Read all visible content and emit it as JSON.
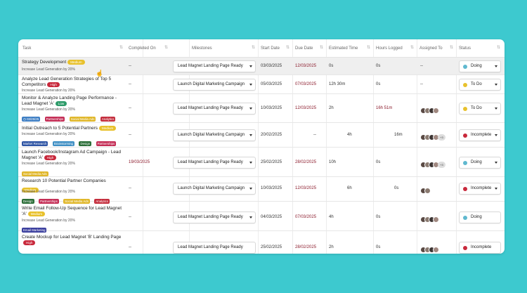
{
  "header": {
    "task": "Task",
    "completed_on": "Completed On",
    "milestones": "Milestones",
    "start_date": "Start Date",
    "due_date": "Due Date",
    "estimated_time": "Estimated Time",
    "hours_logged": "Hours Logged",
    "assigned_to": "Assigned To",
    "status": "Status",
    "sort_glyph": "⇅"
  },
  "colors": {
    "background": "#3dc9cf",
    "due_date_red": "#8b1a2b",
    "status_doing": "#5fb8cf",
    "status_todo": "#e8c12c",
    "status_incomplete": "#c8283b",
    "priority_high": "#c8283b",
    "priority_low": "#2e9b6a",
    "priority_medium": "#e8c12c"
  },
  "tasks": [
    {
      "title": "Strategy Development",
      "priority": "Medium",
      "subtitle": "Increase Lead Generation by 20%",
      "completed_on": "--",
      "milestone": "Lead Magnet Landing Page Ready",
      "start_date": "03/03/2025",
      "due_date": "12/03/2025",
      "estimated": "0s",
      "logged": "0s",
      "assigned": "--",
      "status": "Doing"
    },
    {
      "title": "Analyze Lead Generation Strategies of Top 5 Competitors",
      "priority": "High",
      "subtitle": "Increase Lead Generation by 20%",
      "completed_on": "--",
      "milestone": "Launch Digital Marketing Campaign",
      "start_date": "05/03/2025",
      "due_date": "07/03/2025",
      "estimated": "12h 30m",
      "logged": "0s",
      "assigned": "--",
      "status": "To Do"
    },
    {
      "title": "Monitor & Analyze Landing Page Performance - Lead Magnet 'A'",
      "priority": "Low",
      "subtitle": "Increase Lead Generation by 20%",
      "tags": [
        "03/25/25",
        "Partnerships",
        "Social Media Ads",
        "Analytics"
      ],
      "completed_on": "--",
      "milestone": "Lead Magnet Landing Page Ready",
      "start_date": "10/03/2025",
      "due_date": "12/03/2025",
      "estimated": "2h",
      "logged": "16h 51m",
      "status": "To Do"
    },
    {
      "title": "Initial Outreach to 5 Potential Partners",
      "priority": "Medium",
      "subtitle": "Increase Lead Generation by 20%",
      "tags": [
        "Market Research",
        "Brainstorming",
        "Design",
        "Partnerships"
      ],
      "completed_on": "--",
      "milestone": "Launch Digital Marketing Campaign",
      "start_date": "20/02/2025",
      "due_date": "--",
      "estimated": "4h",
      "logged": "16m",
      "more": "+3",
      "status": "Incomplete"
    },
    {
      "title": "Launch Facebook/Instagram Ad Campaign - Lead Magnet 'A'",
      "priority": "High",
      "subtitle": "Increase Lead Generation by 20%",
      "tags": [
        "Social Media Ads"
      ],
      "completed_on": "19/03/2025",
      "milestone": "Lead Magnet Landing Page Ready",
      "start_date": "25/02/2025",
      "due_date": "28/02/2025",
      "estimated": "10h",
      "logged": "0s",
      "more": "+3",
      "status": "Doing"
    },
    {
      "title": "Research 10 Potential Partner Companies",
      "priority": "Medium",
      "subtitle": "Increase Lead Generation by 20%",
      "tags": [
        "Design",
        "Partnerships",
        "Social Media Ads",
        "Analytics"
      ],
      "completed_on": "--",
      "milestone": "Launch Digital Marketing Campaign",
      "start_date": "10/03/2025",
      "due_date": "12/03/2025",
      "estimated": "6h",
      "logged": "0s",
      "status": "Incomplete"
    },
    {
      "title": "Write Email Follow-Up Sequence for Lead Magnet 'A'",
      "priority": "Medium",
      "subtitle": "Increase Lead Generation by 20%",
      "tags": [
        "Email Marketing"
      ],
      "completed_on": "--",
      "milestone": "Lead Magnet Landing Page Ready",
      "start_date": "04/03/2025",
      "due_date": "07/03/2025",
      "estimated": "4h",
      "logged": "0s",
      "status": "Doing"
    },
    {
      "title": "Create Mockup for Lead Magnet 'B' Landing Page",
      "priority": "High",
      "completed_on": "--",
      "milestone": "Lead Magnet Landing Page Ready",
      "start_date": "25/02/2025",
      "due_date": "28/02/2025",
      "estimated": "2h",
      "logged": "0s",
      "status": "Incomplete"
    }
  ]
}
